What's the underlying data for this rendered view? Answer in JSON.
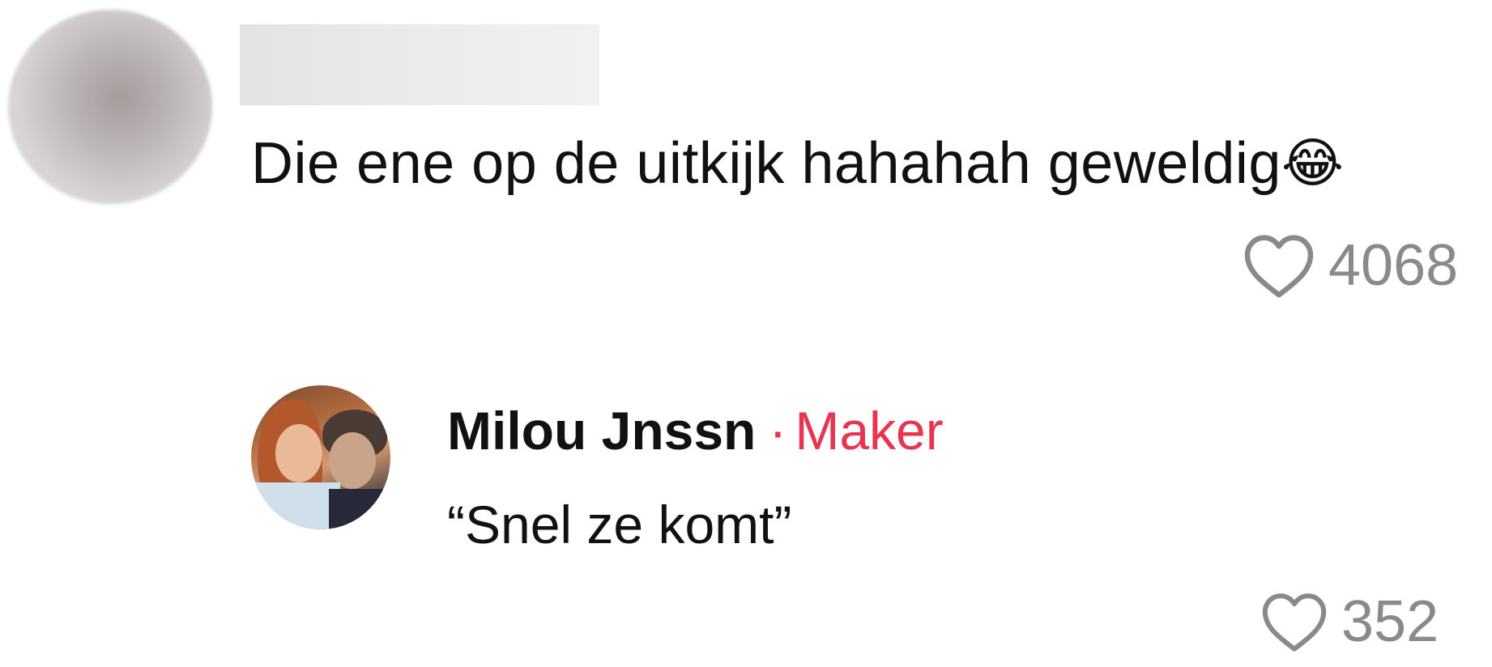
{
  "comments": [
    {
      "text": "Die ene op de uitkijk hahahah geweldig",
      "emoji": "😂",
      "emoji_name": "face-with-tears-of-joy",
      "likes": "4068"
    }
  ],
  "reply": {
    "author": "Milou Jnssn",
    "separator": "·",
    "badge": "Maker",
    "text": "“Snel ze komt”",
    "likes": "352"
  },
  "icons": {
    "like": "heart-outline-icon"
  },
  "colors": {
    "badge": "#e8344f",
    "like_gray": "#8a8a8a",
    "text": "#111111"
  }
}
